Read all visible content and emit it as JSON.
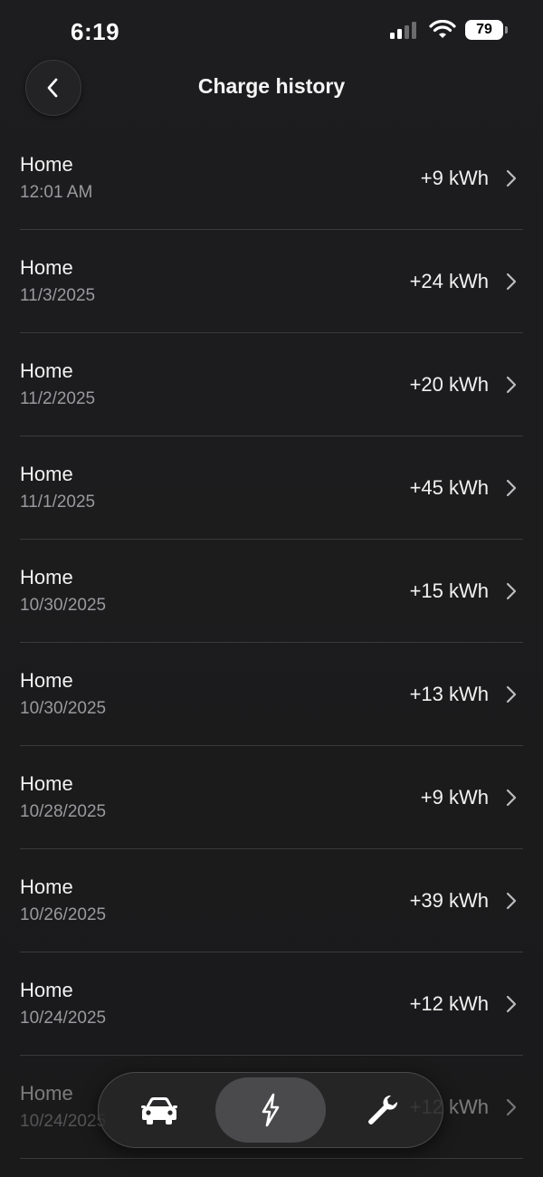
{
  "status_bar": {
    "time": "6:19",
    "battery_level": "79",
    "icons": [
      "signal-icon",
      "wifi-icon",
      "battery-icon"
    ]
  },
  "header": {
    "title": "Charge history",
    "back_icon": "chevron-left-icon"
  },
  "history": [
    {
      "location": "Home",
      "date": "12:01 AM",
      "energy": "+9 kWh"
    },
    {
      "location": "Home",
      "date": "11/3/2025",
      "energy": "+24 kWh"
    },
    {
      "location": "Home",
      "date": "11/2/2025",
      "energy": "+20 kWh"
    },
    {
      "location": "Home",
      "date": "11/1/2025",
      "energy": "+45 kWh"
    },
    {
      "location": "Home",
      "date": "10/30/2025",
      "energy": "+15 kWh"
    },
    {
      "location": "Home",
      "date": "10/30/2025",
      "energy": "+13 kWh"
    },
    {
      "location": "Home",
      "date": "10/28/2025",
      "energy": "+9 kWh"
    },
    {
      "location": "Home",
      "date": "10/26/2025",
      "energy": "+39 kWh"
    },
    {
      "location": "Home",
      "date": "10/24/2025",
      "energy": "+12 kWh"
    },
    {
      "location": "Home",
      "date": "10/24/2025",
      "energy": "+12 kWh"
    }
  ],
  "tab_bar": {
    "tabs": [
      {
        "icon": "car-icon",
        "active": false
      },
      {
        "icon": "lightning-icon",
        "active": true
      },
      {
        "icon": "wrench-icon",
        "active": false
      }
    ]
  },
  "colors": {
    "background": "#1c1c1e",
    "divider": "#3a3a3c",
    "secondary_text": "#9a9a9e",
    "active_tab": "#4a4a4c"
  }
}
